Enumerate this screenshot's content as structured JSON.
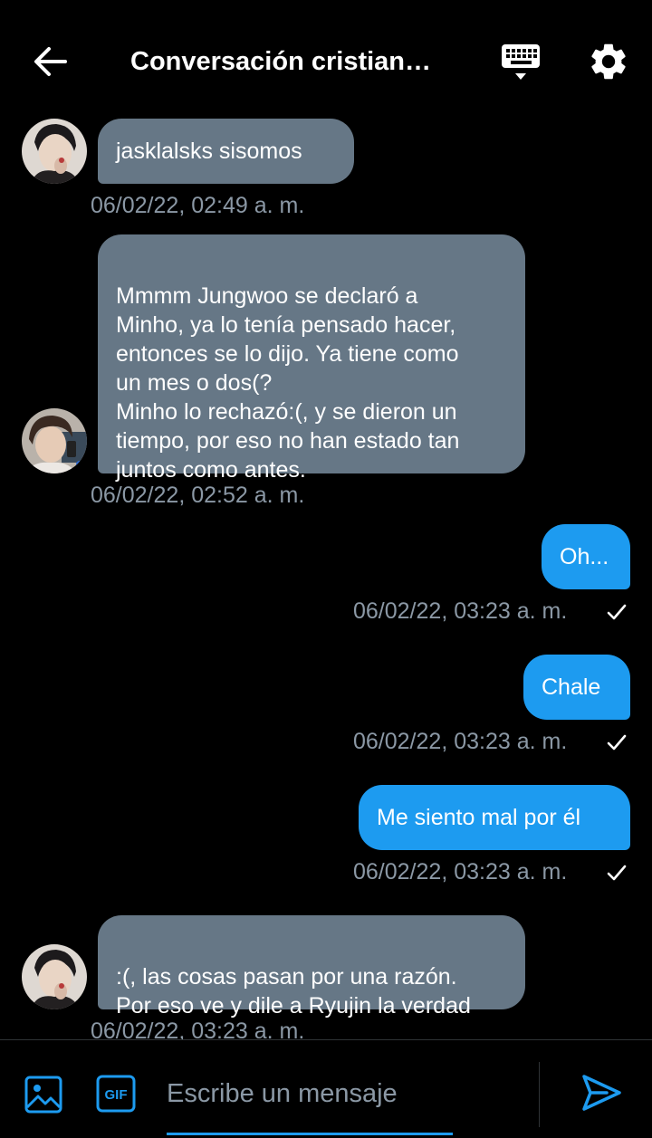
{
  "header": {
    "title": "Conversación cristian…"
  },
  "messages": [
    {
      "direction": "incoming",
      "text": "jasklalsks sisomos",
      "timestamp": "06/02/22, 02:49 a. m."
    },
    {
      "direction": "incoming",
      "text": "Mmmm Jungwoo se declaró a\nMinho, ya lo tenía pensado hacer,\nentonces se lo dijo. Ya tiene como\nun mes o dos(?\nMinho lo rechazó:(, y se dieron un\ntiempo, por eso no han estado tan\njuntos como antes.",
      "timestamp": "06/02/22, 02:52 a. m."
    },
    {
      "direction": "outgoing",
      "text": "Oh...",
      "timestamp": "06/02/22, 03:23 a. m.",
      "status": "sent"
    },
    {
      "direction": "outgoing",
      "text": "Chale",
      "timestamp": "06/02/22, 03:23 a. m.",
      "status": "sent"
    },
    {
      "direction": "outgoing",
      "text": "Me siento mal por él",
      "timestamp": "06/02/22, 03:23 a. m.",
      "status": "sent"
    },
    {
      "direction": "incoming",
      "text": ":(, las cosas pasan por una razón.\nPor eso ve y dile a Ryujin la verdad",
      "timestamp": "06/02/22, 03:23 a. m."
    }
  ],
  "composer": {
    "placeholder": "Escribe un mensaje",
    "gif_label": "GIF"
  },
  "icons": {
    "back": "arrow-left-icon",
    "keyboard": "keyboard-icon",
    "settings": "gear-icon",
    "image": "image-icon",
    "gif": "gif-icon",
    "send": "send-icon",
    "check": "check-icon"
  },
  "colors": {
    "background": "#000000",
    "incoming_bubble": "#667786",
    "outgoing_bubble": "#1d9bf0",
    "timestamp": "#8b98a5",
    "accent": "#1d9bf0"
  }
}
